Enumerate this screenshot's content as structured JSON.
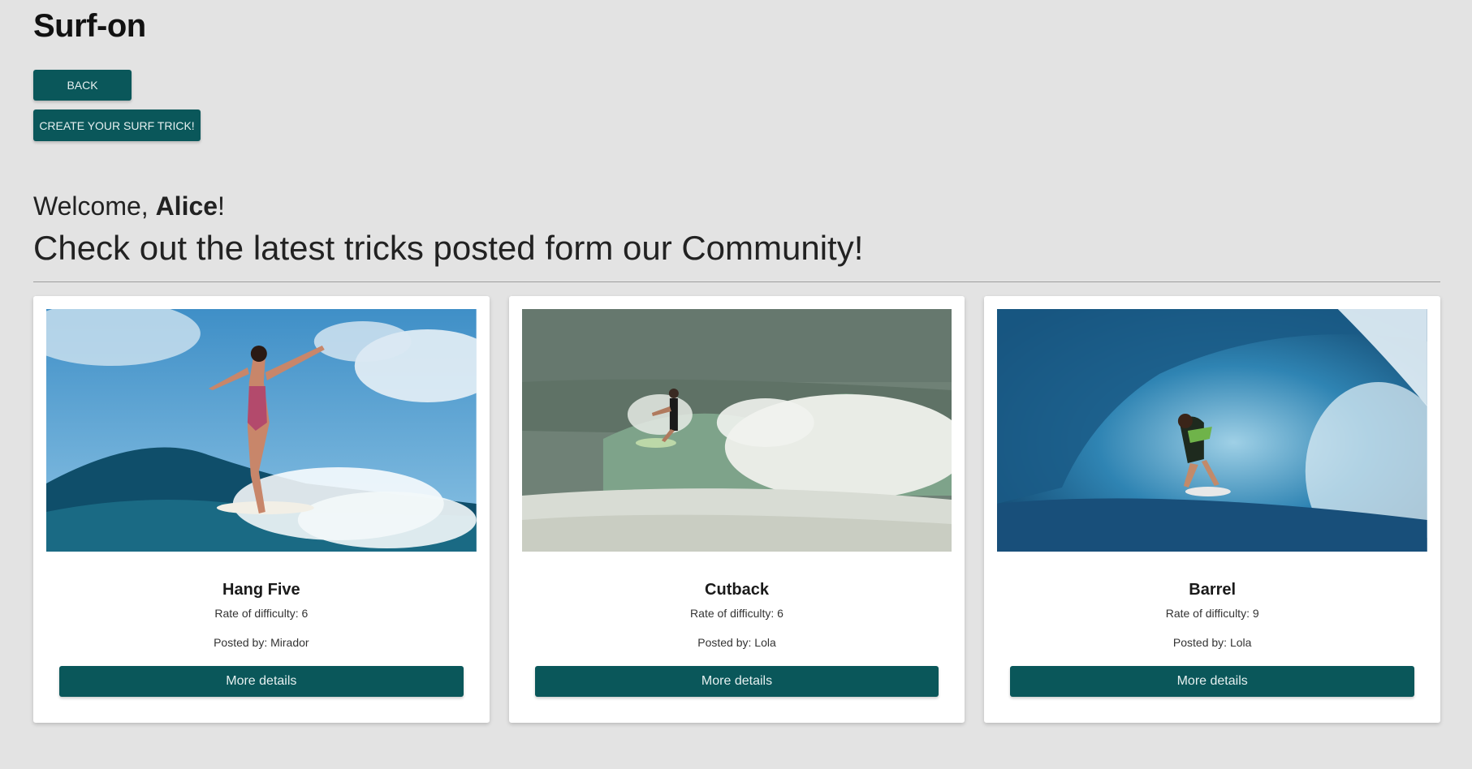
{
  "header": {
    "title": "Surf-on",
    "back_label": "BACK",
    "create_label": "CREATE YOUR SURF TRICK!"
  },
  "welcome": {
    "prefix": "Welcome, ",
    "user": "Alice",
    "suffix": "!",
    "subtitle": "Check out the latest tricks posted form our Community!"
  },
  "colors": {
    "primary": "#0a575a",
    "background": "#e3e3e3",
    "card": "#ffffff"
  },
  "cards": [
    {
      "title": "Hang Five",
      "rate": "Rate of difficulty: 6",
      "posted": "Posted by: Mirador",
      "button": "More details",
      "image": "surfer-hang-five-photo"
    },
    {
      "title": "Cutback",
      "rate": "Rate of difficulty: 6",
      "posted": "Posted by: Lola",
      "button": "More details",
      "image": "surfer-cutback-photo"
    },
    {
      "title": "Barrel",
      "rate": "Rate of difficulty: 9",
      "posted": "Posted by: Lola",
      "button": "More details",
      "image": "surfer-barrel-photo"
    }
  ]
}
